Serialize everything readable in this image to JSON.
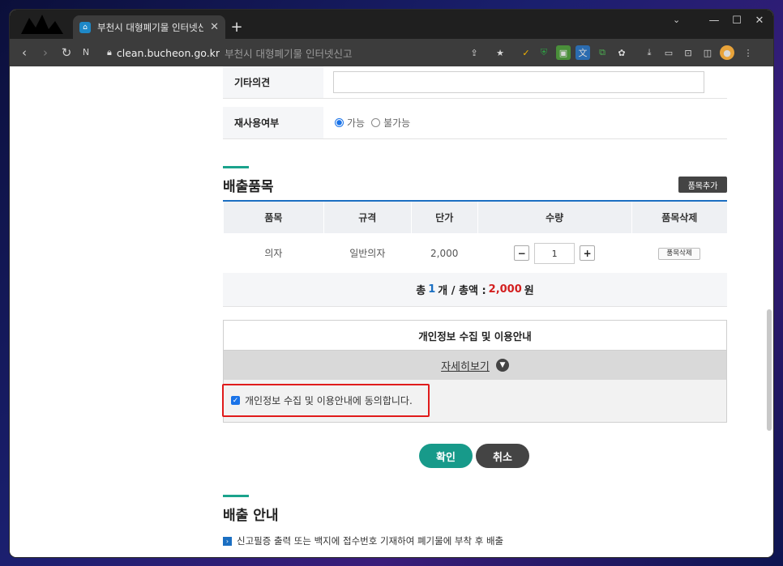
{
  "browser": {
    "tab_title": "부천시 대형폐기물 인터넷신고",
    "favicon": "house-icon",
    "new_tab": "+",
    "url_host": "clean.bucheon.go.kr",
    "url_rest": "부천시 대형폐기물 인터넷신고"
  },
  "form": {
    "other_opinion_label": "기타의견",
    "other_opinion_value": "",
    "reuse_label": "재사용여부",
    "reuse_options": [
      "가능",
      "불가능"
    ],
    "reuse_selected": "가능"
  },
  "items_section": {
    "title": "배출품목",
    "add_button": "품목추가",
    "headers": [
      "품목",
      "규격",
      "단가",
      "수량",
      "품목삭제"
    ],
    "rows": [
      {
        "item": "의자",
        "spec": "일반의자",
        "price": "2,000",
        "quantity": "1",
        "delete_label": "품목삭제"
      }
    ],
    "total": {
      "prefix": "총",
      "count": "1",
      "count_unit": "개 / 총액 :",
      "amount": "2,000",
      "amount_unit": "원"
    }
  },
  "privacy": {
    "heading": "개인정보 수집 및 이용안내",
    "more_link": "자세히보기",
    "agree_label": "개인정보 수집 및 이용안내에 동의합니다.",
    "agreed": true
  },
  "actions": {
    "confirm": "확인",
    "cancel": "취소"
  },
  "guide_section": {
    "title": "배출 안내",
    "line1": "신고필증 출력 또는 백지에 접수번호 기재하여 폐기물에 부착 후 배출"
  },
  "colors": {
    "accent_teal": "#179a8a",
    "table_blue": "#1b6fc2",
    "highlight_red": "#e01b1b",
    "amount_red": "#d32020"
  }
}
